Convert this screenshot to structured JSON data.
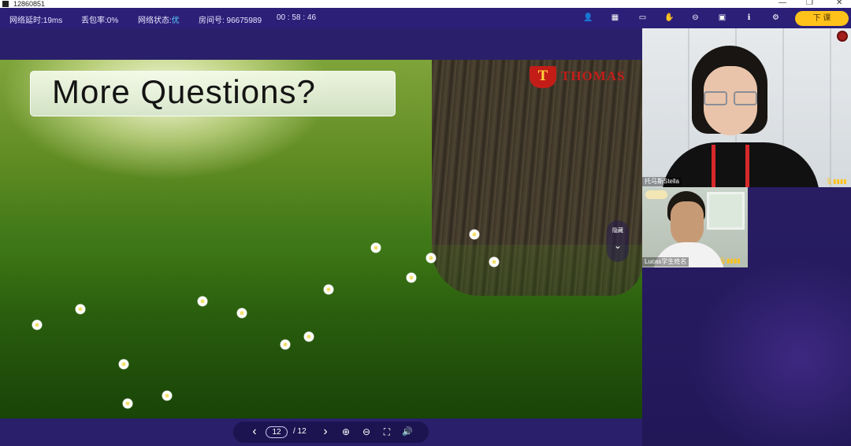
{
  "window": {
    "title": "12860851",
    "controls": [
      "—",
      "❐",
      "✕"
    ]
  },
  "status": {
    "latency": "网络延时:19ms",
    "packet_loss": "丢包率:0%",
    "network_label": "网络状态:",
    "network_value": "优",
    "room": "房间号: 96675989",
    "timer": "00 : 58 : 46"
  },
  "toolbar": {
    "icons": [
      "users-icon",
      "book-icon",
      "whiteboard-icon",
      "pointer-hand-icon",
      "record-icon",
      "save-icon",
      "info-icon",
      "settings-icon"
    ],
    "glyphs": [
      "👤",
      "▦",
      "▭",
      "✋",
      "⊖",
      "▣",
      "ℹ",
      "⚙"
    ],
    "exit_label": "下 课",
    "accent": "#ffc21a"
  },
  "slide": {
    "heading": "More Questions?",
    "logo_letter": "T",
    "logo_text": "THOMAS",
    "side_widget_label": "隐藏",
    "side_widget_glyph": "⌄"
  },
  "pager": {
    "prev": "‹",
    "current_page": "12",
    "total": "/ 12",
    "next": "›",
    "zoom_in": "⊕",
    "zoom_out": "⊖",
    "fullscreen": "⛶",
    "volume": "🔊"
  },
  "videos": {
    "teacher_name": "托马斯Stella",
    "teacher_mic": "🎙▮▮▮▮",
    "student_name": "Lucas学生姓名",
    "student_mic": "🎙▮▮▮▮"
  }
}
